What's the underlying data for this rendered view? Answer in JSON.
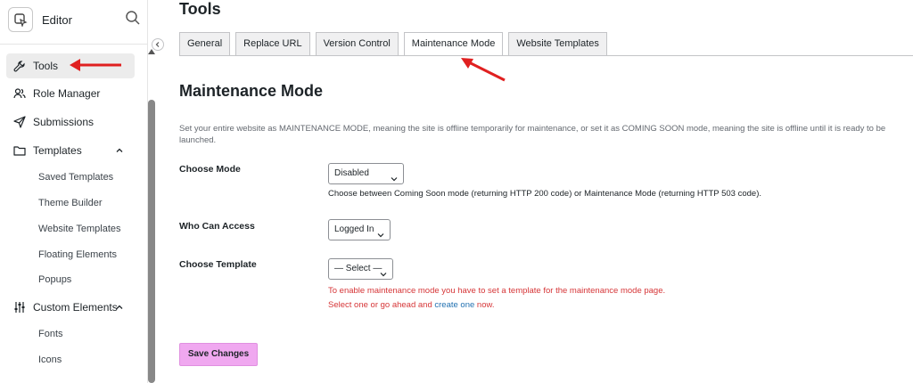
{
  "sidebar": {
    "title": "Editor",
    "nav": [
      {
        "label": "Tools",
        "icon": "wrench-icon"
      },
      {
        "label": "Role Manager",
        "icon": "users-icon"
      },
      {
        "label": "Submissions",
        "icon": "send-icon"
      },
      {
        "label": "Templates",
        "icon": "folder-icon"
      },
      {
        "label": "Custom Elements",
        "icon": "sliders-icon"
      }
    ],
    "template_subitems": [
      "Saved Templates",
      "Theme Builder",
      "Website Templates",
      "Floating Elements",
      "Popups"
    ],
    "custom_subitems": [
      "Fonts",
      "Icons"
    ]
  },
  "main": {
    "title": "Tools",
    "tabs": [
      "General",
      "Replace URL",
      "Version Control",
      "Maintenance Mode",
      "Website Templates"
    ],
    "active_tab": "Maintenance Mode",
    "section_title": "Maintenance Mode",
    "description": "Set your entire website as MAINTENANCE MODE, meaning the site is offline temporarily for maintenance, or set it as COMING SOON mode, meaning the site is offline until it is ready to be launched.",
    "fields": {
      "mode": {
        "label": "Choose Mode",
        "value": "Disabled",
        "help": "Choose between Coming Soon mode (returning HTTP 200 code) or Maintenance Mode (returning HTTP 503 code)."
      },
      "access": {
        "label": "Who Can Access",
        "value": "Logged In"
      },
      "template": {
        "label": "Choose Template",
        "value": "— Select —",
        "warning_line1": "To enable maintenance mode you have to set a template for the maintenance mode page.",
        "warning_line2_prefix": "Select one or go ahead and ",
        "warning_link": "create one",
        "warning_line2_suffix": " now."
      }
    },
    "save_label": "Save Changes"
  },
  "colors": {
    "accent_button": "#f0a8f0",
    "warning": "#d63638",
    "link": "#2271b1",
    "annotation_arrow": "#e02020"
  }
}
